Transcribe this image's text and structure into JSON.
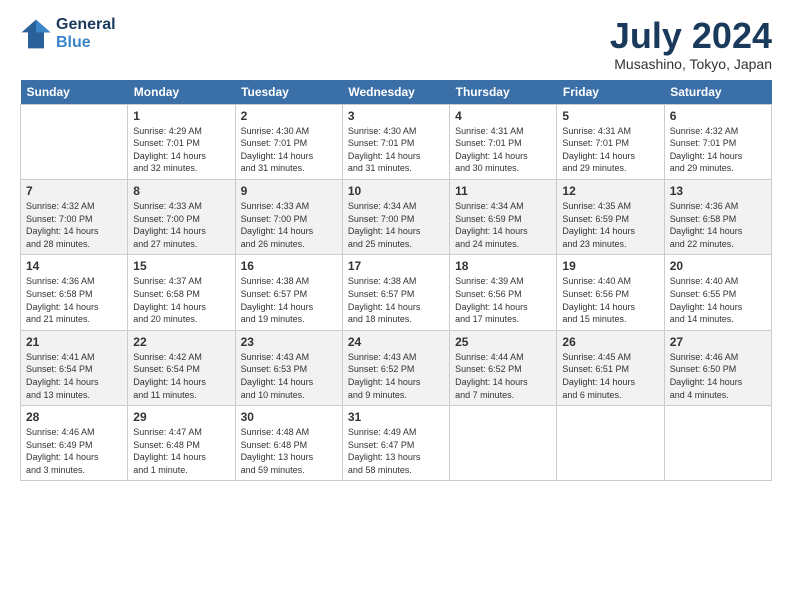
{
  "logo": {
    "line1": "General",
    "line2": "Blue"
  },
  "title": "July 2024",
  "location": "Musashino, Tokyo, Japan",
  "headers": [
    "Sunday",
    "Monday",
    "Tuesday",
    "Wednesday",
    "Thursday",
    "Friday",
    "Saturday"
  ],
  "weeks": [
    [
      {
        "day": "",
        "info": ""
      },
      {
        "day": "1",
        "info": "Sunrise: 4:29 AM\nSunset: 7:01 PM\nDaylight: 14 hours\nand 32 minutes."
      },
      {
        "day": "2",
        "info": "Sunrise: 4:30 AM\nSunset: 7:01 PM\nDaylight: 14 hours\nand 31 minutes."
      },
      {
        "day": "3",
        "info": "Sunrise: 4:30 AM\nSunset: 7:01 PM\nDaylight: 14 hours\nand 31 minutes."
      },
      {
        "day": "4",
        "info": "Sunrise: 4:31 AM\nSunset: 7:01 PM\nDaylight: 14 hours\nand 30 minutes."
      },
      {
        "day": "5",
        "info": "Sunrise: 4:31 AM\nSunset: 7:01 PM\nDaylight: 14 hours\nand 29 minutes."
      },
      {
        "day": "6",
        "info": "Sunrise: 4:32 AM\nSunset: 7:01 PM\nDaylight: 14 hours\nand 29 minutes."
      }
    ],
    [
      {
        "day": "7",
        "info": "Sunrise: 4:32 AM\nSunset: 7:00 PM\nDaylight: 14 hours\nand 28 minutes."
      },
      {
        "day": "8",
        "info": "Sunrise: 4:33 AM\nSunset: 7:00 PM\nDaylight: 14 hours\nand 27 minutes."
      },
      {
        "day": "9",
        "info": "Sunrise: 4:33 AM\nSunset: 7:00 PM\nDaylight: 14 hours\nand 26 minutes."
      },
      {
        "day": "10",
        "info": "Sunrise: 4:34 AM\nSunset: 7:00 PM\nDaylight: 14 hours\nand 25 minutes."
      },
      {
        "day": "11",
        "info": "Sunrise: 4:34 AM\nSunset: 6:59 PM\nDaylight: 14 hours\nand 24 minutes."
      },
      {
        "day": "12",
        "info": "Sunrise: 4:35 AM\nSunset: 6:59 PM\nDaylight: 14 hours\nand 23 minutes."
      },
      {
        "day": "13",
        "info": "Sunrise: 4:36 AM\nSunset: 6:58 PM\nDaylight: 14 hours\nand 22 minutes."
      }
    ],
    [
      {
        "day": "14",
        "info": "Sunrise: 4:36 AM\nSunset: 6:58 PM\nDaylight: 14 hours\nand 21 minutes."
      },
      {
        "day": "15",
        "info": "Sunrise: 4:37 AM\nSunset: 6:58 PM\nDaylight: 14 hours\nand 20 minutes."
      },
      {
        "day": "16",
        "info": "Sunrise: 4:38 AM\nSunset: 6:57 PM\nDaylight: 14 hours\nand 19 minutes."
      },
      {
        "day": "17",
        "info": "Sunrise: 4:38 AM\nSunset: 6:57 PM\nDaylight: 14 hours\nand 18 minutes."
      },
      {
        "day": "18",
        "info": "Sunrise: 4:39 AM\nSunset: 6:56 PM\nDaylight: 14 hours\nand 17 minutes."
      },
      {
        "day": "19",
        "info": "Sunrise: 4:40 AM\nSunset: 6:56 PM\nDaylight: 14 hours\nand 15 minutes."
      },
      {
        "day": "20",
        "info": "Sunrise: 4:40 AM\nSunset: 6:55 PM\nDaylight: 14 hours\nand 14 minutes."
      }
    ],
    [
      {
        "day": "21",
        "info": "Sunrise: 4:41 AM\nSunset: 6:54 PM\nDaylight: 14 hours\nand 13 minutes."
      },
      {
        "day": "22",
        "info": "Sunrise: 4:42 AM\nSunset: 6:54 PM\nDaylight: 14 hours\nand 11 minutes."
      },
      {
        "day": "23",
        "info": "Sunrise: 4:43 AM\nSunset: 6:53 PM\nDaylight: 14 hours\nand 10 minutes."
      },
      {
        "day": "24",
        "info": "Sunrise: 4:43 AM\nSunset: 6:52 PM\nDaylight: 14 hours\nand 9 minutes."
      },
      {
        "day": "25",
        "info": "Sunrise: 4:44 AM\nSunset: 6:52 PM\nDaylight: 14 hours\nand 7 minutes."
      },
      {
        "day": "26",
        "info": "Sunrise: 4:45 AM\nSunset: 6:51 PM\nDaylight: 14 hours\nand 6 minutes."
      },
      {
        "day": "27",
        "info": "Sunrise: 4:46 AM\nSunset: 6:50 PM\nDaylight: 14 hours\nand 4 minutes."
      }
    ],
    [
      {
        "day": "28",
        "info": "Sunrise: 4:46 AM\nSunset: 6:49 PM\nDaylight: 14 hours\nand 3 minutes."
      },
      {
        "day": "29",
        "info": "Sunrise: 4:47 AM\nSunset: 6:48 PM\nDaylight: 14 hours\nand 1 minute."
      },
      {
        "day": "30",
        "info": "Sunrise: 4:48 AM\nSunset: 6:48 PM\nDaylight: 13 hours\nand 59 minutes."
      },
      {
        "day": "31",
        "info": "Sunrise: 4:49 AM\nSunset: 6:47 PM\nDaylight: 13 hours\nand 58 minutes."
      },
      {
        "day": "",
        "info": ""
      },
      {
        "day": "",
        "info": ""
      },
      {
        "day": "",
        "info": ""
      }
    ]
  ]
}
